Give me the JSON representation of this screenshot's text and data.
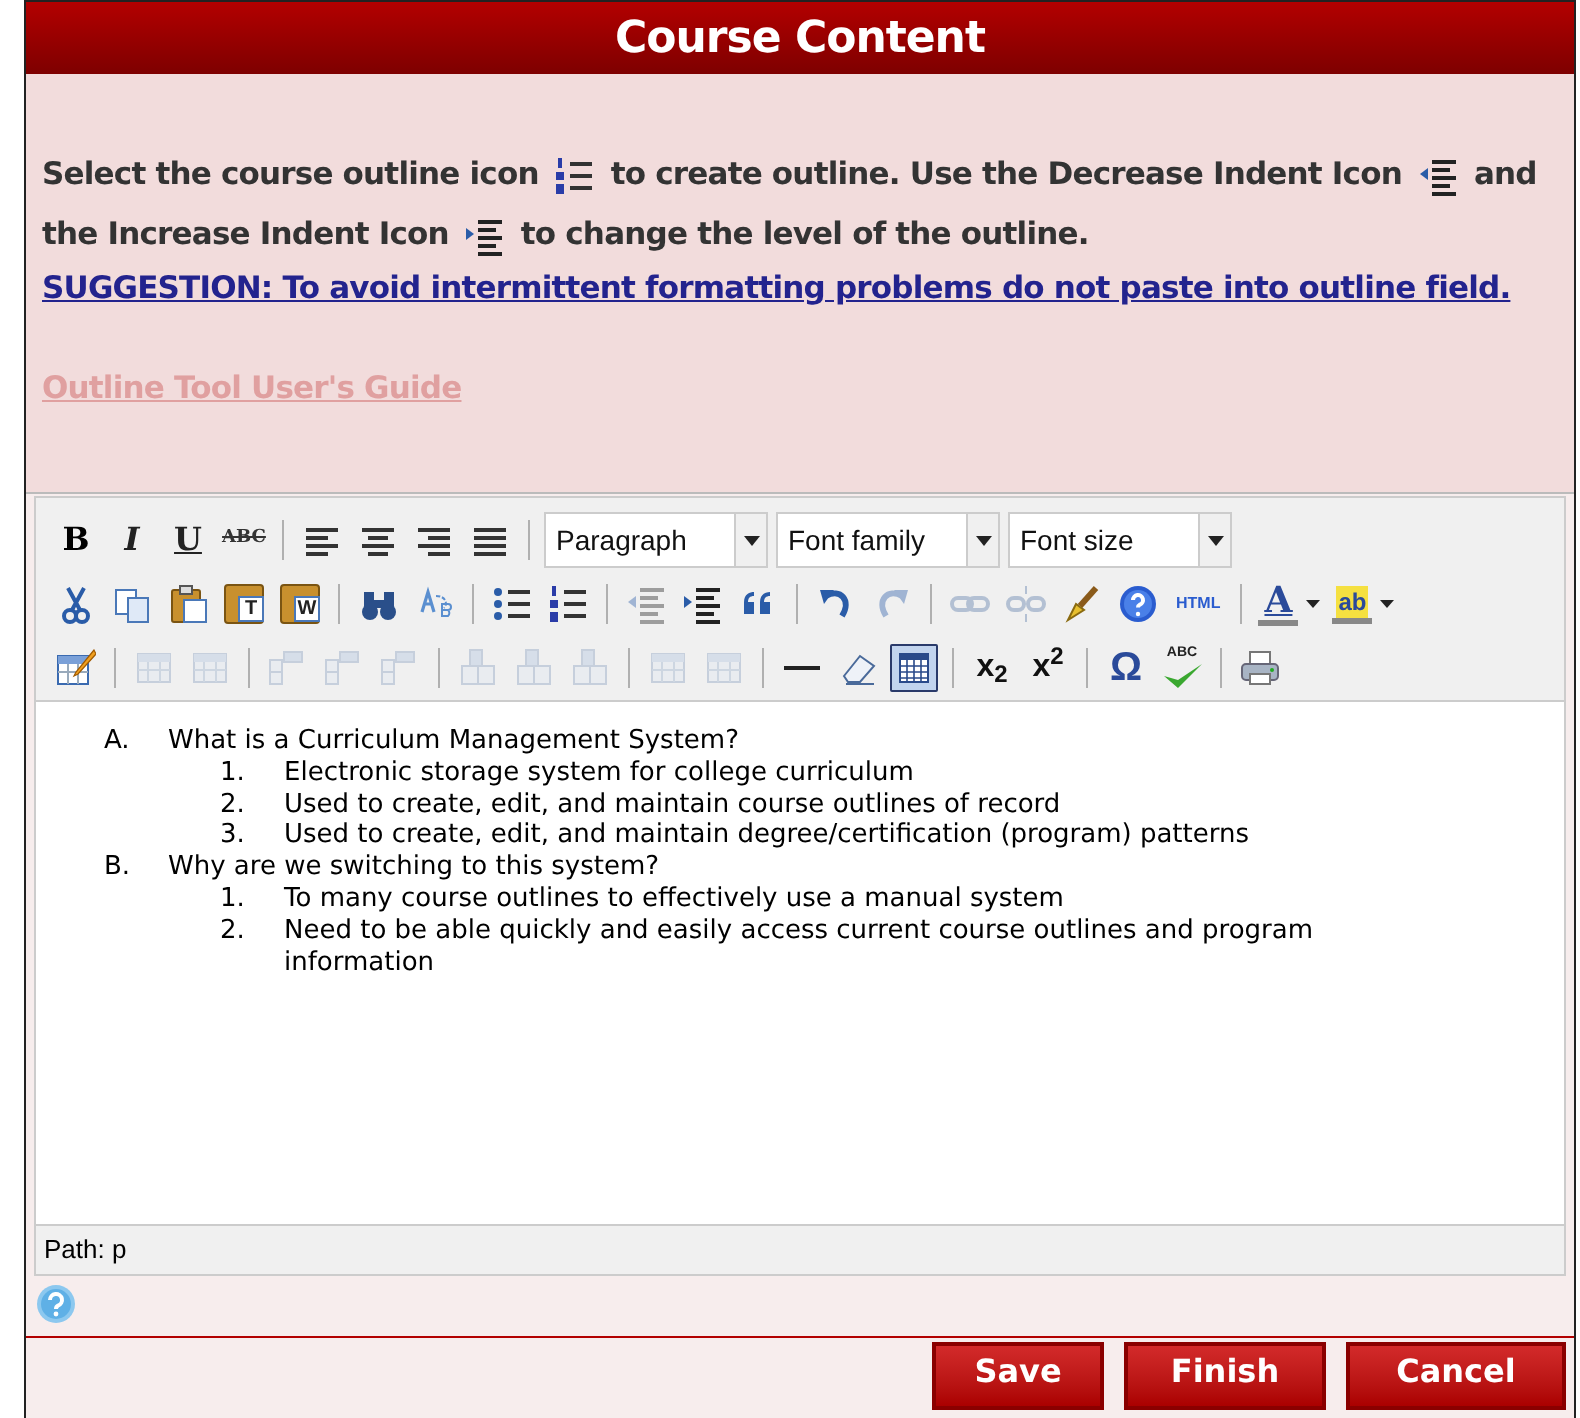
{
  "header": {
    "title": "Course Content"
  },
  "instructions": {
    "lines": [
      [
        {
          "kind": "text",
          "text": "Select the course outline icon"
        },
        {
          "kind": "icon"
        },
        {
          "kind": "text",
          "text": "to create outline. Use the Decrease Indent Icon"
        },
        {
          "kind": "icon"
        },
        {
          "kind": "text",
          "text": "and"
        }
      ],
      [
        {
          "kind": "text",
          "text": "the Increase Indent Icon"
        },
        {
          "kind": "icon"
        },
        {
          "kind": "text",
          "text": "to change the level of the outline."
        }
      ]
    ],
    "suggestion": "SUGGESTION: To avoid intermittent formatting problems do not paste into outline field.",
    "guide_link": "Outline Tool User's Guide"
  },
  "toolbar": [
    [
      {
        "kind": "glyph",
        "glyph": "B",
        "disabled": false
      },
      {
        "kind": "glyph",
        "glyph": "I",
        "disabled": false
      },
      {
        "kind": "glyph",
        "glyph": "U",
        "disabled": false
      },
      {
        "kind": "glyph",
        "glyph": "ABC",
        "disabled": false
      },
      {
        "kind": "separator"
      },
      {
        "kind": "icon",
        "disabled": false
      },
      {
        "kind": "icon",
        "disabled": false
      },
      {
        "kind": "icon",
        "disabled": false
      },
      {
        "kind": "icon",
        "disabled": false
      },
      {
        "kind": "separator"
      },
      {
        "kind": "select",
        "value": "Paragraph"
      },
      {
        "kind": "select",
        "value": "Font family"
      },
      {
        "kind": "select",
        "value": "Font size"
      }
    ],
    [
      {
        "kind": "icon",
        "disabled": false
      },
      {
        "kind": "icon",
        "disabled": false
      },
      {
        "kind": "icon",
        "disabled": false
      },
      {
        "kind": "glyph",
        "glyph": "T",
        "disabled": false
      },
      {
        "kind": "glyph",
        "glyph": "W",
        "disabled": false
      },
      {
        "kind": "separator"
      },
      {
        "kind": "icon",
        "disabled": false
      },
      {
        "kind": "icon",
        "disabled": false
      },
      {
        "kind": "separator"
      },
      {
        "kind": "icon",
        "disabled": false
      },
      {
        "kind": "icon",
        "disabled": false
      },
      {
        "kind": "separator"
      },
      {
        "kind": "icon",
        "disabled": true
      },
      {
        "kind": "icon",
        "disabled": false
      },
      {
        "kind": "icon",
        "disabled": false
      },
      {
        "kind": "separator"
      },
      {
        "kind": "icon",
        "disabled": false
      },
      {
        "kind": "icon",
        "disabled": true
      },
      {
        "kind": "separator"
      },
      {
        "kind": "icon",
        "disabled": true
      },
      {
        "kind": "icon",
        "disabled": true
      },
      {
        "kind": "icon",
        "disabled": false
      },
      {
        "kind": "icon",
        "disabled": false
      },
      {
        "kind": "glyph",
        "glyph": "HTML",
        "disabled": false
      },
      {
        "kind": "separator"
      },
      {
        "kind": "glyph",
        "glyph": "A",
        "disabled": false
      },
      {
        "kind": "glyph",
        "glyph": "ab",
        "disabled": false
      }
    ],
    [
      {
        "kind": "icon",
        "disabled": false
      },
      {
        "kind": "separator"
      },
      {
        "kind": "icon",
        "disabled": true
      },
      {
        "kind": "icon",
        "disabled": true
      },
      {
        "kind": "separator"
      },
      {
        "kind": "icon",
        "disabled": true
      },
      {
        "kind": "icon",
        "disabled": true
      },
      {
        "kind": "icon",
        "disabled": true
      },
      {
        "kind": "separator"
      },
      {
        "kind": "icon",
        "disabled": true
      },
      {
        "kind": "icon",
        "disabled": true
      },
      {
        "kind": "icon",
        "disabled": true
      },
      {
        "kind": "separator"
      },
      {
        "kind": "icon",
        "disabled": true
      },
      {
        "kind": "icon",
        "disabled": true
      },
      {
        "kind": "separator"
      },
      {
        "kind": "icon",
        "disabled": false
      },
      {
        "kind": "icon",
        "disabled": false
      },
      {
        "kind": "icon",
        "disabled": false,
        "selected": true
      },
      {
        "kind": "separator"
      },
      {
        "kind": "glyph",
        "glyph": "x$_{2}$",
        "disabled": false
      },
      {
        "kind": "glyph",
        "glyph": "x$^{2}$",
        "disabled": false
      },
      {
        "kind": "separator"
      },
      {
        "kind": "glyph",
        "glyph": "Ω",
        "disabled": false
      },
      {
        "kind": "glyph",
        "glyph": "ABC",
        "disabled": false
      },
      {
        "kind": "separator"
      },
      {
        "kind": "icon",
        "disabled": false
      }
    ]
  ],
  "outline": [
    {
      "marker": "A.",
      "text": "What is a Curriculum Management System?",
      "children": [
        {
          "marker": "1.",
          "text": "Electronic storage system for college curriculum"
        },
        {
          "marker": "2.",
          "text": "Used to create, edit, and maintain course outlines of record"
        },
        {
          "marker": "3.",
          "text": "Used to create, edit, and maintain degree/certification (program) patterns"
        }
      ]
    },
    {
      "marker": "B.",
      "text": "Why are we switching to this system?",
      "children": [
        {
          "marker": "1.",
          "text": "To many course outlines to effectively use a manual system"
        },
        {
          "marker": "2.",
          "text": "Need to be able quickly and easily access current course outlines and program information"
        }
      ]
    }
  ],
  "status_path": "Path: p",
  "buttons": [
    {
      "label": "Save"
    },
    {
      "label": "Finish"
    },
    {
      "label": "Cancel"
    }
  ]
}
